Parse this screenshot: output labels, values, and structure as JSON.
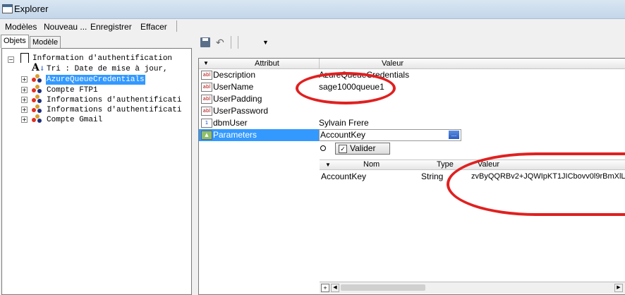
{
  "window": {
    "title": "Explorer"
  },
  "menu": [
    "Modèles",
    "Nouveau ...",
    "Enregistrer",
    "Effacer"
  ],
  "tabs": [
    "Objets",
    "Modèle"
  ],
  "tree": {
    "root": "Information d'authentification",
    "items": [
      "Tri   : Date de mise à jour,",
      "AzureQueueCredentials",
      "Compte FTP1",
      "Informations d'authentificati",
      "Informations d'authentificati",
      "Compte Gmail"
    ],
    "selected_index": 1
  },
  "grid": {
    "headers": {
      "attribut": "Attribut",
      "valeur": "Valeur"
    },
    "rows": [
      {
        "icon": "abl",
        "name": "Description",
        "value": "AzureQueueCredentials"
      },
      {
        "icon": "abl",
        "name": "UserName",
        "value": "sage1000queue1"
      },
      {
        "icon": "abl",
        "name": "UserPadding",
        "value": ""
      },
      {
        "icon": "abl",
        "name": "UserPassword",
        "value": ""
      },
      {
        "icon": "1",
        "name": "dbmUser",
        "value": "Sylvain Frere"
      },
      {
        "icon": "image",
        "name": "Parameters",
        "value": "AccountKey"
      }
    ],
    "ellipsis": "..."
  },
  "sub": {
    "validate_label": "Valider",
    "headers": {
      "nom": "Nom",
      "type": "Type",
      "valeur": "Valeur"
    },
    "rows": [
      {
        "nom": "AccountKey",
        "type": "String",
        "valeur": "zvByQQRBv2+JQWIpKT1JICbovv0l9rBmXlL"
      }
    ],
    "add": "+"
  }
}
